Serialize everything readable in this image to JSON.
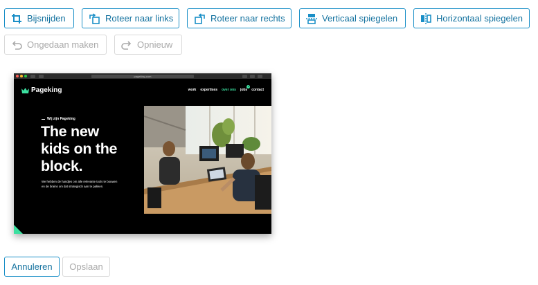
{
  "toolbar": {
    "crop_label": "Bijsnijden",
    "rotate_left_label": "Roteer naar links",
    "rotate_right_label": "Roteer naar rechts",
    "flip_vertical_label": "Verticaal spiegelen",
    "flip_horizontal_label": "Horizontaal spiegelen",
    "undo_label": "Ongedaan maken",
    "redo_label": "Opnieuw"
  },
  "preview": {
    "url": "pageking.com",
    "brand": "Pageking",
    "nav": [
      "work",
      "expertises",
      "over ons",
      "jobs",
      "contact"
    ],
    "nav_active": "over ons",
    "jobs_badge": "1",
    "eyebrow": "Wij zijn Pageking",
    "headline": "The new\nkids on the\nblock.",
    "subtext": "We hebben de handjes om alle relevante tools te bouwen en de brains om dat strategisch aan te pakken."
  },
  "footer": {
    "cancel_label": "Annuleren",
    "save_label": "Opslaan"
  },
  "colors": {
    "primary": "#1a8fc7",
    "primary_text": "#14729f",
    "disabled_border": "#d9d9d9",
    "disabled_text": "#a9a9a9",
    "brand_accent": "#3ce0a0"
  }
}
